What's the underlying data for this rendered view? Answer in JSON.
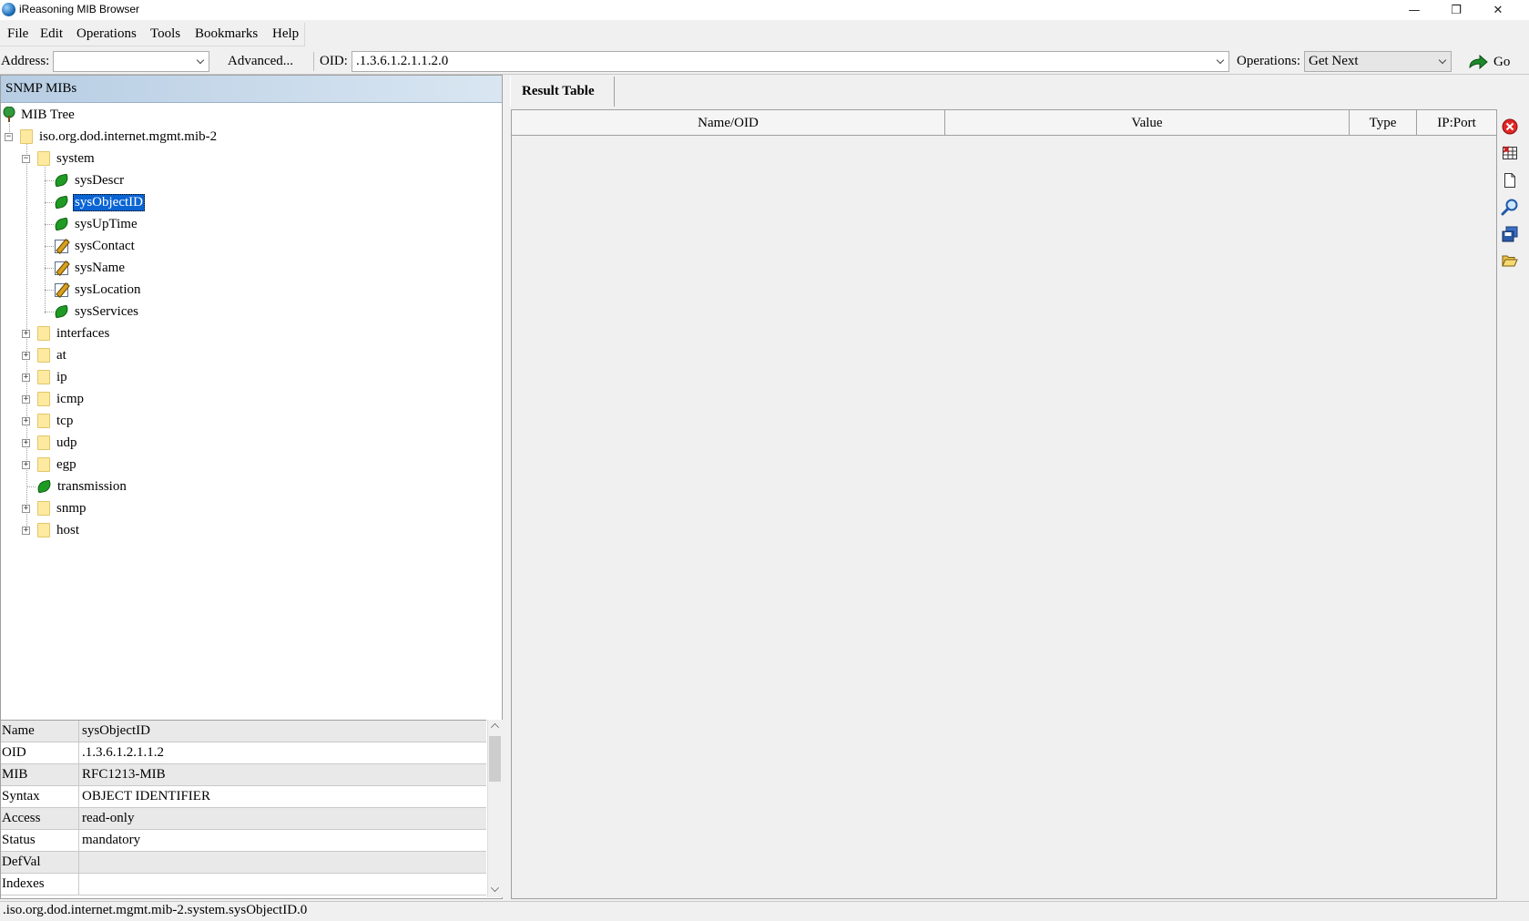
{
  "window": {
    "title": "iReasoning MIB Browser",
    "minimize_glyph": "—",
    "restore_glyph": "❐",
    "close_glyph": "✕"
  },
  "menu": [
    "File",
    "Edit",
    "Operations",
    "Tools",
    "Bookmarks",
    "Help"
  ],
  "toolbar": {
    "address_label": "Address:",
    "address_value": "",
    "advanced_label": "Advanced...",
    "oid_label": "OID:",
    "oid_value": ".1.3.6.1.2.1.1.2.0",
    "operations_label": "Operations:",
    "operations_value": "Get Next",
    "go_label": "Go"
  },
  "left_panel": {
    "header": "SNMP MIBs",
    "tree": {
      "root": "MIB Tree",
      "mib2": "iso.org.dod.internet.mgmt.mib-2",
      "system": "system",
      "system_children": [
        "sysDescr",
        "sysObjectID",
        "sysUpTime",
        "sysContact",
        "sysName",
        "sysLocation",
        "sysServices"
      ],
      "groups": [
        "interfaces",
        "at",
        "ip",
        "icmp",
        "tcp",
        "udp",
        "egp",
        "transmission",
        "snmp",
        "host"
      ],
      "selected": "sysObjectID"
    }
  },
  "properties": [
    {
      "key": "Name",
      "value": "sysObjectID"
    },
    {
      "key": "OID",
      "value": ".1.3.6.1.2.1.1.2"
    },
    {
      "key": "MIB",
      "value": "RFC1213-MIB"
    },
    {
      "key": "Syntax",
      "value": "OBJECT IDENTIFIER"
    },
    {
      "key": "Access",
      "value": "read-only"
    },
    {
      "key": "Status",
      "value": "mandatory"
    },
    {
      "key": "DefVal",
      "value": ""
    },
    {
      "key": "Indexes",
      "value": ""
    }
  ],
  "result": {
    "tab_label": "Result Table",
    "columns": [
      "Name/OID",
      "Value",
      "Type",
      "IP:Port"
    ]
  },
  "side_toolbar_icons": [
    "stop-icon",
    "delete-table-icon",
    "new-document-icon",
    "find-icon",
    "save-icon",
    "open-folder-icon"
  ],
  "status": ".iso.org.dod.internet.mgmt.mib-2.system.sysObjectID.0",
  "colors": {
    "selection": "#0a64d4",
    "header_gradient_start": "#b7cde3",
    "leaf_green": "#1f9a24",
    "folder_yellow": "#fde9a0"
  }
}
